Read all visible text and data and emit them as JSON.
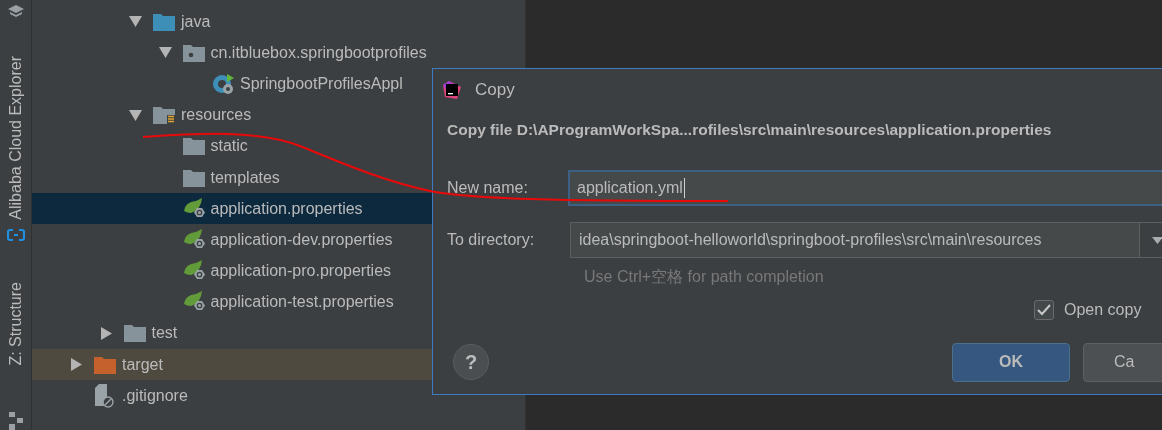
{
  "tool_windows": [
    {
      "label": "Alibaba Cloud Explorer"
    },
    {
      "label": "Z: Structure"
    }
  ],
  "tree": [
    {
      "children": [
        {
          "children": [
            {
              "label": "java",
              "kind": "source-folder",
              "expanded": true,
              "selected": false,
              "children": [
                {
                  "label": "cn.itbluebox.springbootprofiles",
                  "kind": "package",
                  "expanded": true,
                  "selected": false,
                  "children": [
                    {
                      "label": "SpringbootProfilesAppl",
                      "kind": "spring-class",
                      "selected": false
                    }
                  ]
                }
              ]
            },
            {
              "label": "resources",
              "kind": "resources-folder",
              "expanded": true,
              "selected": false,
              "children": [
                {
                  "label": "static",
                  "kind": "folder",
                  "selected": false
                },
                {
                  "label": "templates",
                  "kind": "folder",
                  "selected": false
                },
                {
                  "label": "application.properties",
                  "kind": "spring-config",
                  "selected": true
                },
                {
                  "label": "application-dev.properties",
                  "kind": "spring-config",
                  "selected": false
                },
                {
                  "label": "application-pro.properties",
                  "kind": "spring-config",
                  "selected": false
                },
                {
                  "label": "application-test.properties",
                  "kind": "spring-config",
                  "selected": false
                }
              ]
            }
          ]
        },
        {
          "label": "test",
          "kind": "folder",
          "expanded": false,
          "selected": false
        }
      ]
    },
    {
      "label": "target",
      "kind": "excluded-folder",
      "expanded": false,
      "selected": false
    },
    {
      "label": ".gitignore",
      "kind": "ignore-file",
      "selected": false
    }
  ],
  "dialog": {
    "title": "Copy",
    "message": "Copy file D:\\AProgramWorkSpa...rofiles\\src\\main\\resources\\application.properties",
    "fields": [
      {
        "label": "New name:",
        "value": "application.yml",
        "kind": "text",
        "focused": true
      },
      {
        "label": "To directory:",
        "value": "idea\\springboot-helloworld\\springboot-profiles\\src\\main\\resources",
        "kind": "dropdown",
        "focused": false
      }
    ],
    "hint": "Use Ctrl+空格 for path completion",
    "open_copy": {
      "label": "Open copy",
      "checked": true
    },
    "help": "?",
    "buttons": [
      {
        "label": "OK",
        "default": true
      },
      {
        "label": "Ca",
        "default": false
      }
    ]
  }
}
